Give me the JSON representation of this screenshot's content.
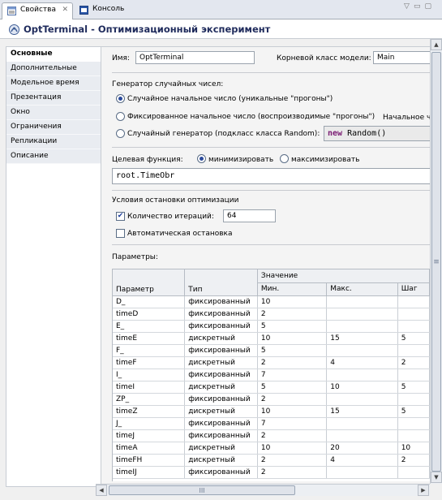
{
  "tabs": [
    {
      "label": "Свойства",
      "active": true
    },
    {
      "label": "Консоль",
      "active": false
    }
  ],
  "title": "OptTerminal - Оптимизационный эксперимент",
  "nav": [
    "Основные",
    "Дополнительные",
    "Модельное время",
    "Презентация",
    "Окно",
    "Ограничения",
    "Репликации",
    "Описание"
  ],
  "general": {
    "name_label": "Имя:",
    "name_value": "OptTerminal",
    "root_label": "Корневой класс модели:",
    "root_value": "Main"
  },
  "rng": {
    "label": "Генератор случайных чисел:",
    "opt_random": "Случайное начальное число (уникальные \"прогоны\")",
    "opt_fixed": "Фиксированное начальное число (воспроизводимые \"прогоны\")",
    "seed_label": "Начальное ч",
    "opt_custom": "Случайный генератор (подкласс класса Random):",
    "custom_code_kw": "new",
    "custom_code_rest": " Random()"
  },
  "objective": {
    "label": "Целевая функция:",
    "minimize": "минимизировать",
    "maximize": "максимизировать",
    "expr": "root.TimeObr"
  },
  "stop": {
    "label": "Условия остановки оптимизации",
    "iterations_label": "Количество итераций:",
    "iterations_value": "64",
    "auto_label": "Автоматическая остановка"
  },
  "params": {
    "label": "Параметры:",
    "header_group": "Значение",
    "headers": [
      "Параметр",
      "Тип",
      "Мин.",
      "Макс.",
      "Шаг"
    ],
    "rows": [
      [
        "D_",
        "фиксированный",
        "10",
        "",
        ""
      ],
      [
        "timeD",
        "фиксированный",
        "2",
        "",
        ""
      ],
      [
        "E_",
        "фиксированный",
        "5",
        "",
        ""
      ],
      [
        "timeE",
        "дискретный",
        "10",
        "15",
        "5"
      ],
      [
        "F_",
        "фиксированный",
        "5",
        "",
        ""
      ],
      [
        "timeF",
        "дискретный",
        "2",
        "4",
        "2"
      ],
      [
        "I_",
        "фиксированный",
        "7",
        "",
        ""
      ],
      [
        "timeI",
        "дискретный",
        "5",
        "10",
        "5"
      ],
      [
        "ZP_",
        "фиксированный",
        "2",
        "",
        ""
      ],
      [
        "timeZ",
        "дискретный",
        "10",
        "15",
        "5"
      ],
      [
        "J_",
        "фиксированный",
        "7",
        "",
        ""
      ],
      [
        "timeJ",
        "фиксированный",
        "2",
        "",
        ""
      ],
      [
        "timeA",
        "дискретный",
        "10",
        "20",
        "10"
      ],
      [
        "timeFH",
        "дискретный",
        "2",
        "4",
        "2"
      ],
      [
        "timeIJ",
        "фиксированный",
        "2",
        "",
        ""
      ]
    ]
  },
  "scroll": {
    "hthumb_label": "III",
    "vthumb_label": "≡"
  }
}
